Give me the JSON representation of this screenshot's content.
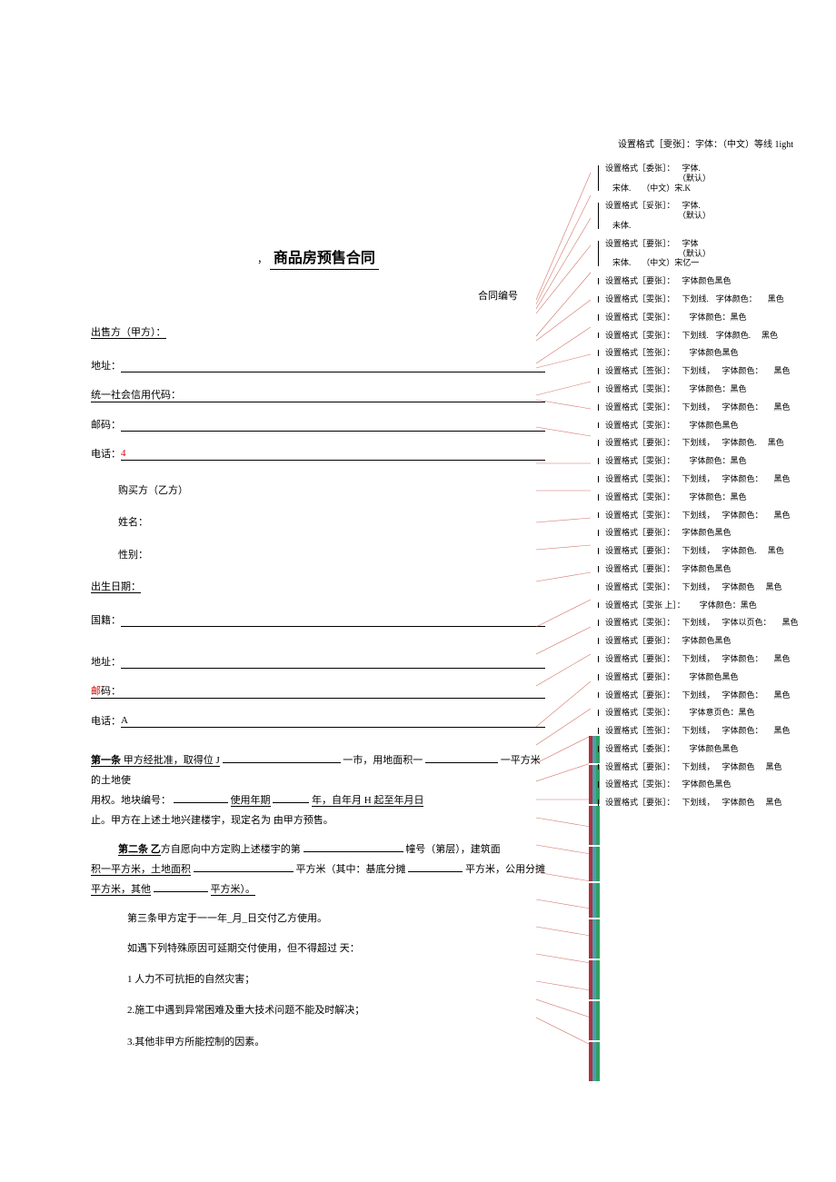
{
  "top_comment": "设置格式［雯张］：字体：（中文）等线 1ight",
  "title_prefix": "，",
  "title": "商品房预售合同",
  "contract_no_label": "合同编号",
  "seller": {
    "label": "出售方（甲方）：",
    "address_label": "地址：",
    "credit_label": "统一社会信用代码：",
    "post_label": "邮码：",
    "phone_label": "电话：",
    "phone_value": "4"
  },
  "buyer": {
    "label": "购买方（乙方）",
    "name_label": "姓名：",
    "gender_label": "性别：",
    "dob_label": "出生日期：",
    "nationality_label": "国籍：",
    "address_label": "地址：",
    "post_label": "邮",
    "post_label2": "码：",
    "phone_label": "电话：",
    "phone_value": "A"
  },
  "article1": {
    "lead": "第一条",
    "text1": " 甲方经批准，取得位 J",
    "text2": "一市，用地面积一",
    "text3": "一平方米的土地使",
    "text4": "用权。地块编号：",
    "text5": "使用年期",
    "text6": "年，自年月 H 起至年月日",
    "text7": "止。甲方在上述土地兴建楼宇，现定名为 由甲方预售。"
  },
  "article2": {
    "lead": "第二条 乙",
    "text1": "方自愿向中方定购上述楼宇的第",
    "text2": "幢号（第层），建筑面",
    "text3": "积一平方米，土地面积",
    "text4": "平方米（其中：基底分摊",
    "text5": "平方米，公用分摊",
    "text6": "平方米，其他",
    "text7": "平方米）。"
  },
  "article3": {
    "text": "第三条甲方定于一一年_月_日交付乙方使用。",
    "delay": "如遇下列特殊原因可延期交付使用，但不得超过 天：",
    "items": [
      "1 人力不可抗拒的自然灾害；",
      "2.施工中遇到异常困难及重大技术问题不能及时解决；",
      "3.其他非甲方所能控制的因素。"
    ]
  },
  "comments": [
    {
      "author": "委张",
      "c2": "字体.",
      "sub": "（默认）",
      "c3": "宋体.",
      "c4": "（中文）宋.K"
    },
    {
      "author": "妥张",
      "c2": "字体.",
      "sub": "（默认）",
      "c3": "未体."
    },
    {
      "author": "要张",
      "c2": "字体",
      "sub": "（默认）",
      "c3": "宋体.",
      "c4": "（中文）宋亿一"
    },
    {
      "author": "要张",
      "c2": "字体颜色黑色"
    },
    {
      "author": "雯张",
      "c2": "下划线.",
      "c3": "字体颜色：",
      "c4": "黑色"
    },
    {
      "author": "雯张",
      "c2": "",
      "c3": "字体颜色：黑色"
    },
    {
      "author": "雯张",
      "c2": "下划线.",
      "c3": "字体颜色.",
      "c4": "黑色"
    },
    {
      "author": "签张",
      "c2": "",
      "c3": "字体颜色黑色"
    },
    {
      "author": "签张",
      "c2": "下划线，",
      "c3": "字体颜色：",
      "c4": "黑色"
    },
    {
      "author": "雯张",
      "c2": "",
      "c3": "字体颜色：黑色"
    },
    {
      "author": "雯张",
      "c2": "下划线，",
      "c3": "字体颜色：",
      "c4": "黑色"
    },
    {
      "author": "雯张",
      "c2": "",
      "c3": "字体颜色黑色"
    },
    {
      "author": "要张",
      "c2": "下划线，",
      "c3": "字体颜色.",
      "c4": "黑色"
    },
    {
      "author": "雯张",
      "c2": "",
      "c3": "字体颜色：黑色"
    },
    {
      "author": "雯张",
      "c2": "下划线，",
      "c3": "字体颜色：",
      "c4": "黑色"
    },
    {
      "author": "雯张",
      "c2": "",
      "c3": "字体颜色：黑色"
    },
    {
      "author": "雯张",
      "c2": "下划线，",
      "c3": "字体颜色：",
      "c4": "黑色"
    },
    {
      "author": "要张",
      "c2": "字体颜色黑色"
    },
    {
      "author": "要张",
      "c2": "下划线，",
      "c3": "字体颜色.",
      "c4": "黑色"
    },
    {
      "author": "要张",
      "c2": "字体颜色黑色"
    },
    {
      "author": "雯张",
      "c2": "下划线，",
      "c3": "字体颜色",
      "c4": "黑色"
    },
    {
      "author": "雯张 上",
      "c2": "",
      "c3": "字体颜色：黑色"
    },
    {
      "author": "雯张",
      "c2": "下划线，",
      "c3": "字体以页色：",
      "c4": "黑色"
    },
    {
      "author": "要张",
      "c2": "字体颜色黑色"
    },
    {
      "author": "要张",
      "c2": "下划线，",
      "c3": "字体颜色：",
      "c4": "黑色"
    },
    {
      "author": "要张",
      "c2": "",
      "c3": "字体颜色黑色"
    },
    {
      "author": "要张",
      "c2": "下划线，",
      "c3": "字体颜色：",
      "c4": "黑色"
    },
    {
      "author": "雯张",
      "c2": "",
      "c3": "字体意页色：黑色"
    },
    {
      "author": "签张",
      "c2": "下划线，",
      "c3": "字体颜色：",
      "c4": "黑色"
    },
    {
      "author": "委张",
      "c2": "",
      "c3": "字体颜色黑色"
    },
    {
      "author": "要张",
      "c2": "下划线，",
      "c3": "字体颜色",
      "c4": "黑色"
    },
    {
      "author": "雯张",
      "c2": "字体颜色黑色"
    },
    {
      "author": "要张",
      "c2": "下划线，",
      "c3": "字体颜色",
      "c4": "黑色"
    }
  ],
  "comment_prefix": "设置格式［",
  "comment_suffix": "］："
}
